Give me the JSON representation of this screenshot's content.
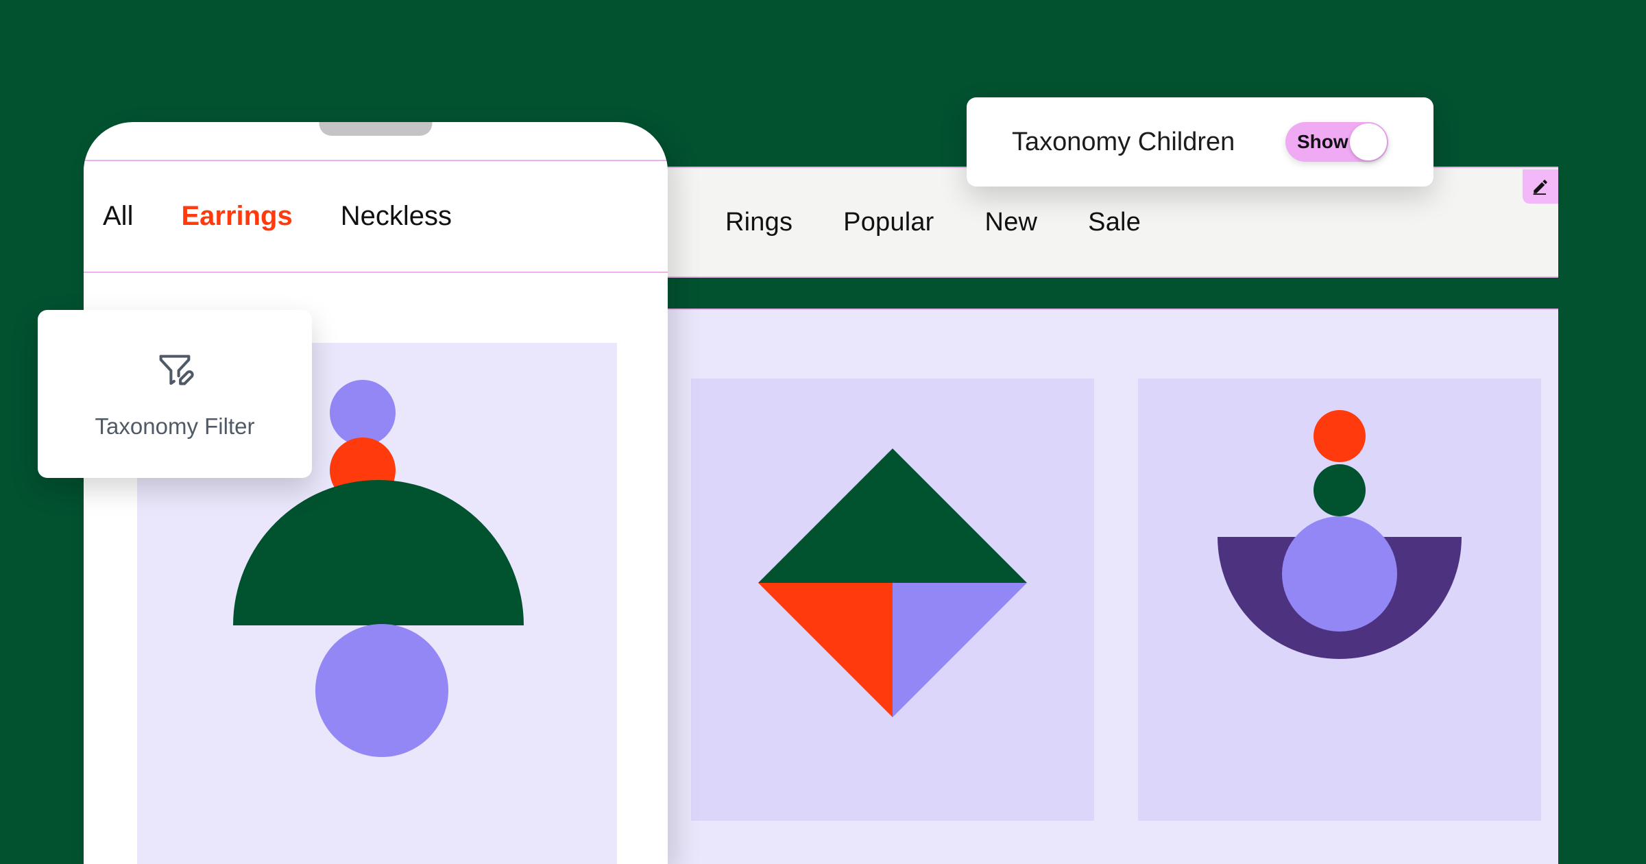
{
  "theme": {
    "background_green": "#02512f",
    "accent_orange": "#ff3b0d",
    "accent_pink": "#f0aaf4",
    "border_pink": "#efb0ef",
    "purple_light": "#9287f5",
    "purple_dark": "#4c327f",
    "surface_lavender": "#eae6fb",
    "card_lavender": "#dcd6fa",
    "navbar_gray": "#f4f4f3"
  },
  "phone": {
    "tabs": [
      {
        "label": "All",
        "active": false
      },
      {
        "label": "Earrings",
        "active": true
      },
      {
        "label": "Neckless",
        "active": false
      }
    ],
    "product": {
      "name": "earring-composition",
      "shapes": [
        {
          "type": "circle",
          "color": "#9287f5"
        },
        {
          "type": "circle",
          "color": "#ff3b0d"
        },
        {
          "type": "dome",
          "color": "#01522f"
        },
        {
          "type": "circle",
          "color": "#9287f5"
        }
      ]
    }
  },
  "browser": {
    "tabs": [
      {
        "label": "Rings"
      },
      {
        "label": "Popular"
      },
      {
        "label": "New"
      },
      {
        "label": "Sale"
      }
    ],
    "edit_button": {
      "icon": "pencil-icon",
      "label": ""
    },
    "products": [
      {
        "name": "diamond-composition",
        "shapes": [
          {
            "type": "triangle-up",
            "color": "#01522f"
          },
          {
            "type": "triangle-down-left",
            "color": "#ff3b0d"
          },
          {
            "type": "triangle-down-right",
            "color": "#9287f5"
          }
        ]
      },
      {
        "name": "pendant-composition",
        "shapes": [
          {
            "type": "circle",
            "color": "#ff3b0d"
          },
          {
            "type": "circle",
            "color": "#01522f"
          },
          {
            "type": "bowl",
            "color": "#4c327f"
          },
          {
            "type": "circle",
            "color": "#9287f5"
          }
        ]
      }
    ]
  },
  "taxonomy_filter_card": {
    "icon": "funnel-edit-icon",
    "label": "Taxonomy Filter"
  },
  "taxonomy_children_card": {
    "label": "Taxonomy Children",
    "toggle": {
      "state_label": "Show",
      "enabled": true
    }
  }
}
